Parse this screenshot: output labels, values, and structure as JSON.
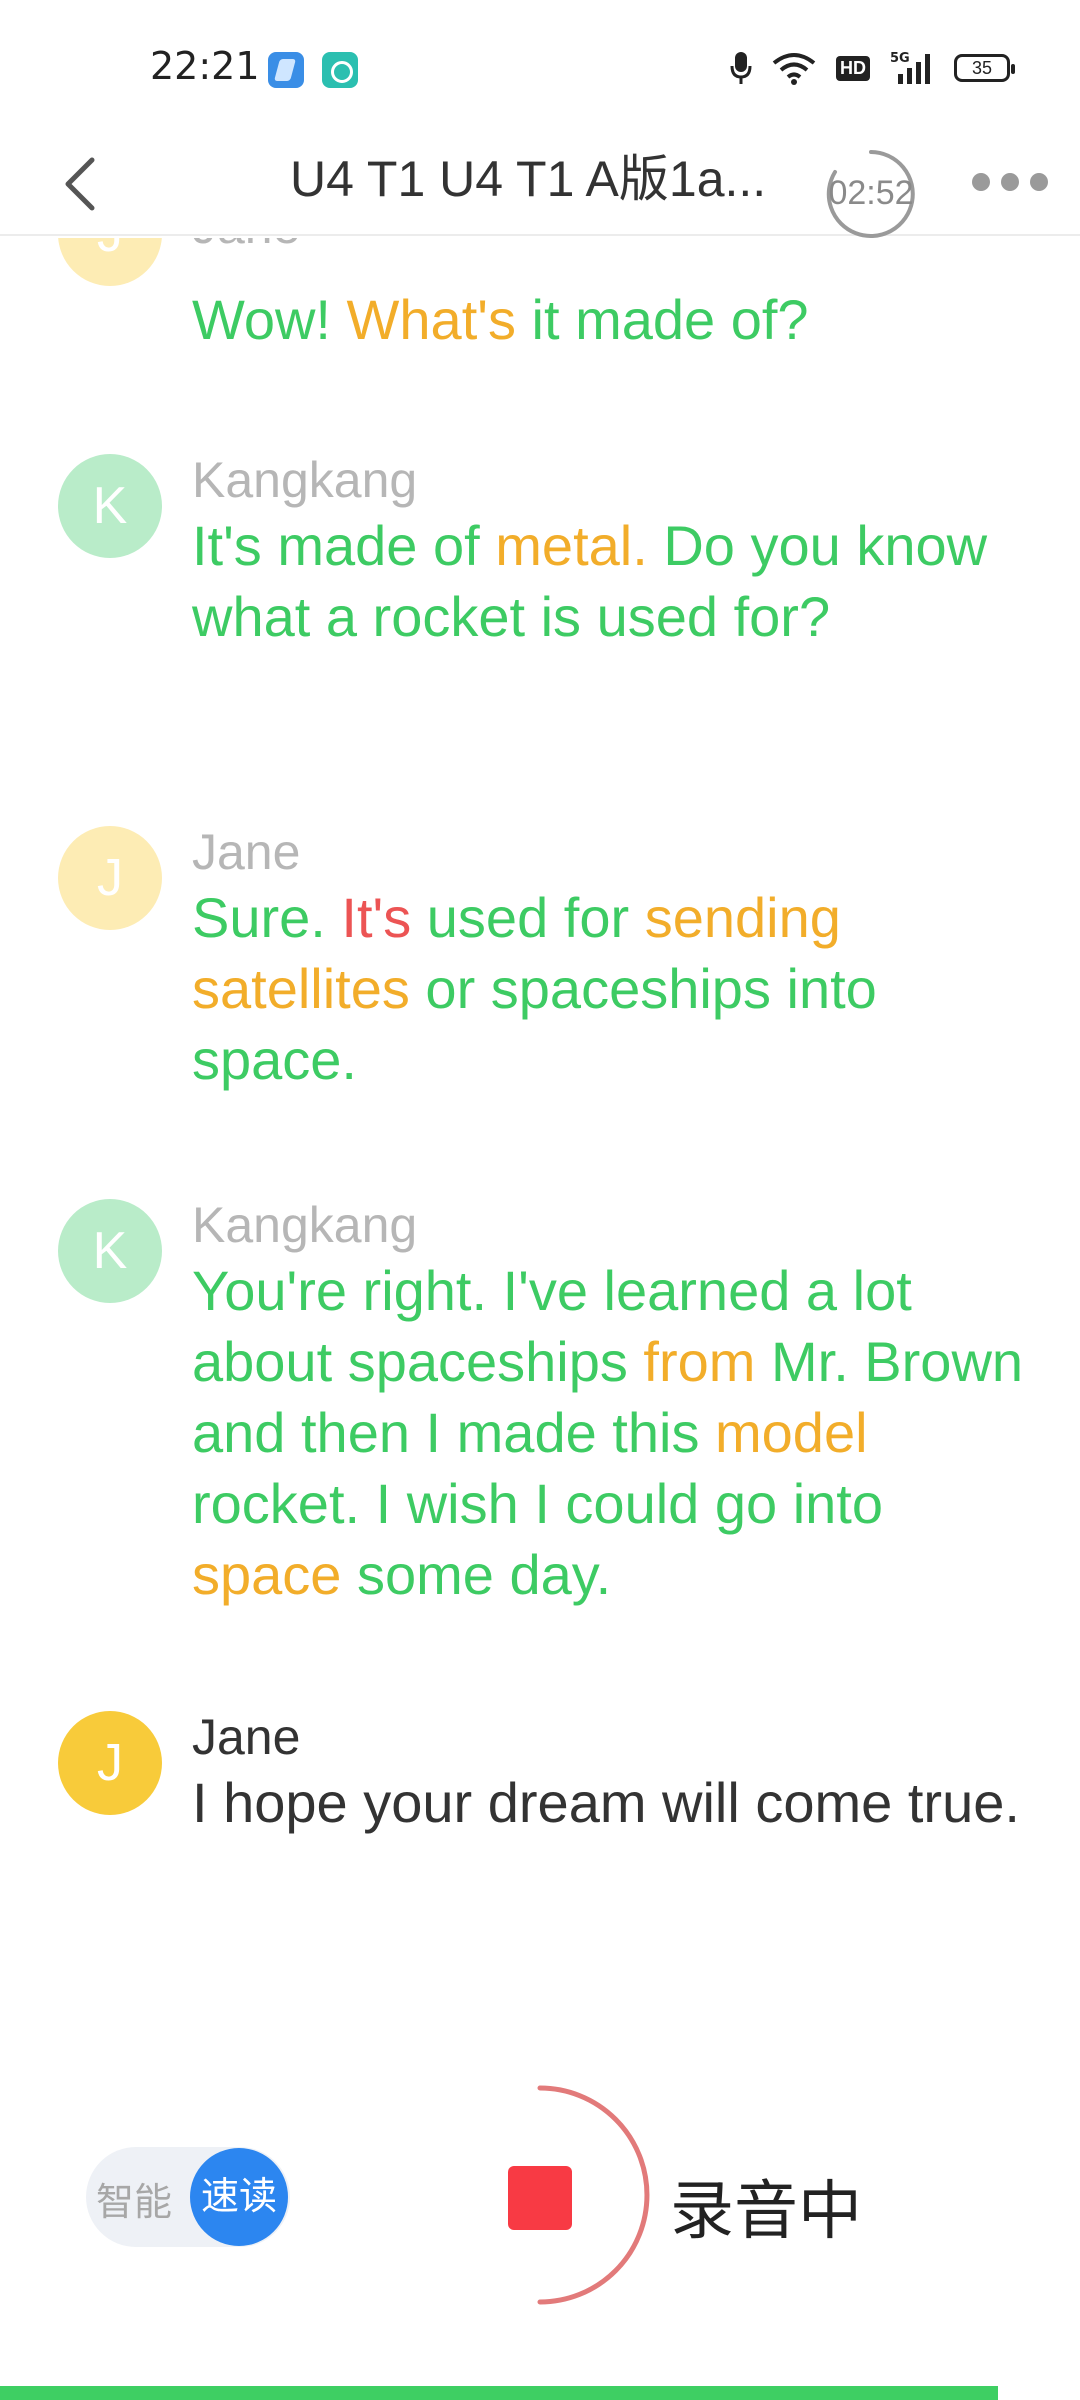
{
  "status_bar": {
    "time": "22:21",
    "battery": "35",
    "hd": "HD",
    "network": "5G"
  },
  "nav": {
    "title": "U4 T1 U4 T1 A版1a...",
    "timer": "02:52",
    "back_icon": "chevron-left-icon",
    "more_icon": "more-dots-icon"
  },
  "colors": {
    "correct_green": "#3dcb63",
    "warn_orange": "#f2ad2a",
    "wrong_red": "#ec5454",
    "active_text": "#333333",
    "accent_blue": "#2c86f0",
    "record_red": "#f83a44"
  },
  "dialogue": [
    {
      "speaker": "Jane",
      "avatar": "J",
      "segments": [
        {
          "t": "Wow! ",
          "c": "g"
        },
        {
          "t": "What's",
          "c": "o"
        },
        {
          "t": " it made of?",
          "c": "g"
        }
      ]
    },
    {
      "speaker": "Kangkang",
      "avatar": "K",
      "segments": [
        {
          "t": "It's made of ",
          "c": "g"
        },
        {
          "t": "metal.",
          "c": "o"
        },
        {
          "t": " Do you know what a rocket is used for?",
          "c": "g"
        }
      ]
    },
    {
      "speaker": "Jane",
      "avatar": "J",
      "segments": [
        {
          "t": "Sure. ",
          "c": "g"
        },
        {
          "t": "It's",
          "c": "r"
        },
        {
          "t": " used for ",
          "c": "g"
        },
        {
          "t": "sending satellites",
          "c": "o"
        },
        {
          "t": " or spaceships into space.",
          "c": "g"
        }
      ]
    },
    {
      "speaker": "Kangkang",
      "avatar": "K",
      "segments": [
        {
          "t": "You're right. I've learned a lot about spaceships ",
          "c": "g"
        },
        {
          "t": "from",
          "c": "o"
        },
        {
          "t": " Mr. Brown and then I made this ",
          "c": "g"
        },
        {
          "t": "model",
          "c": "o"
        },
        {
          "t": " rocket. I wish I could go into ",
          "c": "g"
        },
        {
          "t": "space",
          "c": "o"
        },
        {
          "t": " some day.",
          "c": "g"
        }
      ]
    },
    {
      "speaker": "Jane",
      "avatar": "J",
      "segments": [
        {
          "t": "I hope your dream will come true.",
          "c": "n"
        }
      ]
    }
  ],
  "controls": {
    "mode_smart": "智能",
    "mode_speed": "速读",
    "recording_label": "录音中"
  }
}
